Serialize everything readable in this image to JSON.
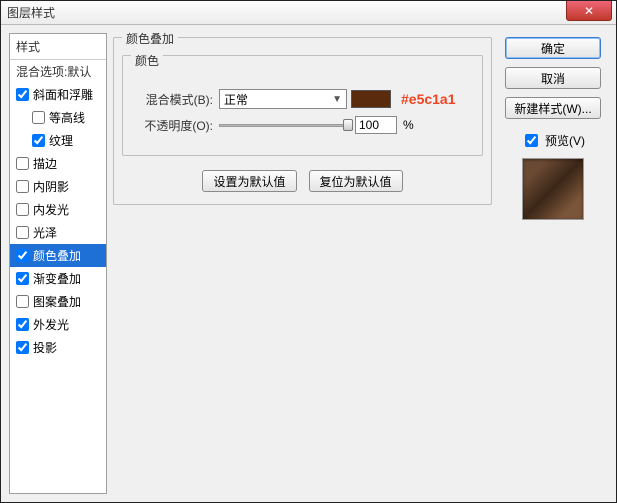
{
  "title": "图层样式",
  "closeGlyph": "✕",
  "left": {
    "header": "样式",
    "sub": "混合选项:默认",
    "items": [
      {
        "label": "斜面和浮雕",
        "checked": true,
        "indent": false
      },
      {
        "label": "等高线",
        "checked": false,
        "indent": true
      },
      {
        "label": "纹理",
        "checked": true,
        "indent": true
      },
      {
        "label": "描边",
        "checked": false,
        "indent": false
      },
      {
        "label": "内阴影",
        "checked": false,
        "indent": false
      },
      {
        "label": "内发光",
        "checked": false,
        "indent": false
      },
      {
        "label": "光泽",
        "checked": false,
        "indent": false
      },
      {
        "label": "颜色叠加",
        "checked": true,
        "indent": false,
        "selected": true
      },
      {
        "label": "渐变叠加",
        "checked": true,
        "indent": false
      },
      {
        "label": "图案叠加",
        "checked": false,
        "indent": false
      },
      {
        "label": "外发光",
        "checked": true,
        "indent": false
      },
      {
        "label": "投影",
        "checked": true,
        "indent": false
      }
    ]
  },
  "mid": {
    "groupTitle": "颜色叠加",
    "colorGroup": "颜色",
    "blendLabel": "混合模式(B):",
    "blendValue": "正常",
    "colorHex": "#5a2b0c",
    "annotation": "#e5c1a1",
    "opacityLabel": "不透明度(O):",
    "opacityValue": "100",
    "pct": "%",
    "setDefault": "设置为默认值",
    "resetDefault": "复位为默认值"
  },
  "right": {
    "ok": "确定",
    "cancel": "取消",
    "newStyle": "新建样式(W)...",
    "previewLabel": "预览(V)"
  }
}
